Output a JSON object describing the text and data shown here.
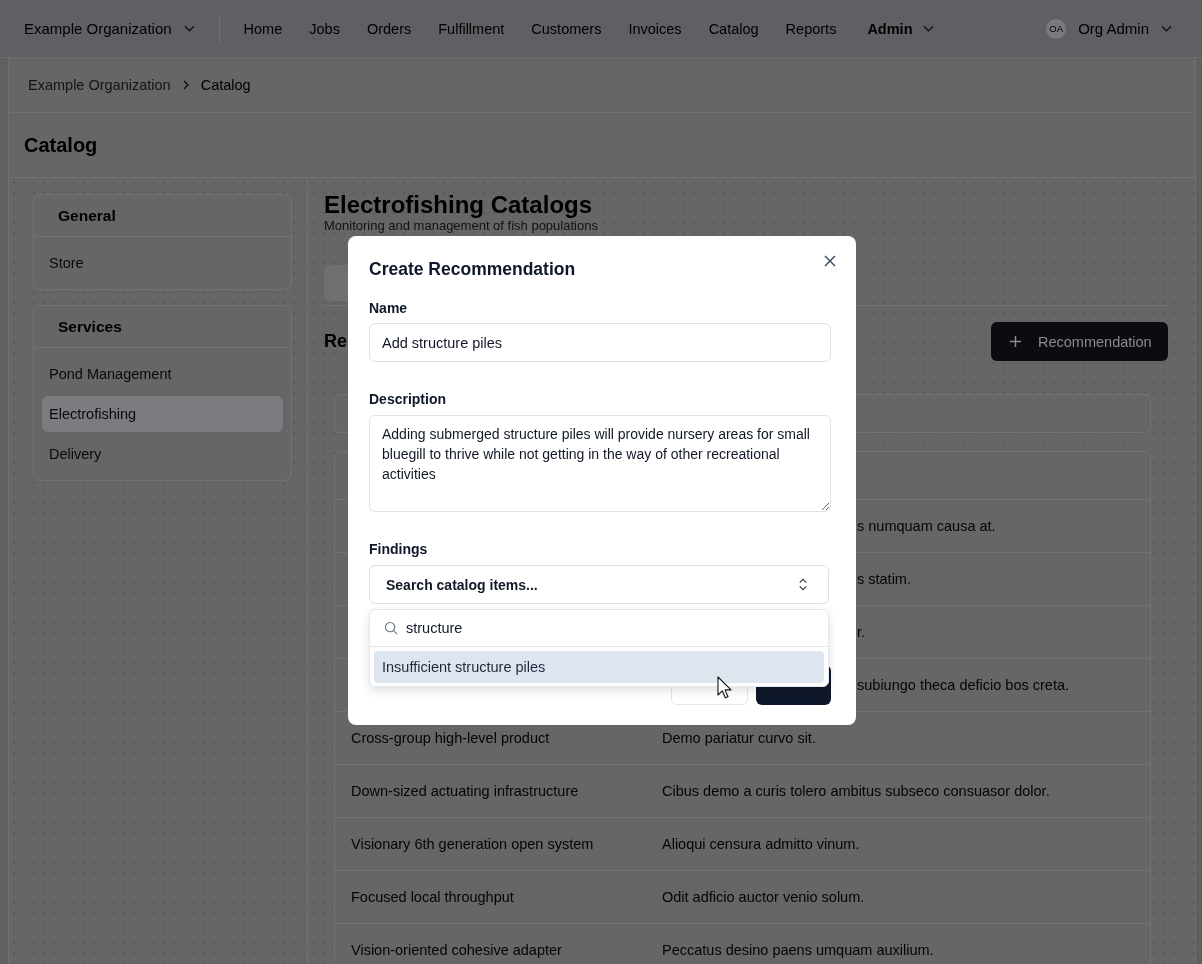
{
  "top_nav": {
    "organization": "Example Organization",
    "links": [
      {
        "label": "Home",
        "kind": "link"
      },
      {
        "label": "Jobs",
        "kind": "link"
      },
      {
        "label": "Orders",
        "kind": "link"
      },
      {
        "label": "Fulfillment",
        "kind": "link"
      },
      {
        "label": "Customers",
        "kind": "link"
      },
      {
        "label": "Invoices",
        "kind": "link"
      },
      {
        "label": "Catalog",
        "kind": "link"
      },
      {
        "label": "Reports",
        "kind": "link"
      },
      {
        "label": "Admin",
        "kind": "dropdown"
      }
    ],
    "user": {
      "initials": "OA",
      "name": "Org Admin"
    }
  },
  "breadcrumbs": [
    {
      "label": "Example Organization",
      "current": false
    },
    {
      "label": "Catalog",
      "current": true
    }
  ],
  "page_title": "Catalog",
  "sidebar": {
    "sections": [
      {
        "title": "General",
        "items": [
          {
            "label": "Store",
            "selected": false
          }
        ]
      },
      {
        "title": "Services",
        "items": [
          {
            "label": "Pond Management",
            "selected": false
          },
          {
            "label": "Electrofishing",
            "selected": true
          },
          {
            "label": "Delivery",
            "selected": false
          }
        ]
      }
    ]
  },
  "main": {
    "title": "Electrofishing Catalogs",
    "subtitle": "Monitoring and management of fish populations",
    "section_title": "Re",
    "add_button": "Recommendation",
    "table": {
      "rows": [
        {
          "kind": "fragment",
          "description": "s numquam causa at."
        },
        {
          "kind": "fragment",
          "description": "s statim."
        },
        {
          "kind": "fragment",
          "description": "r."
        },
        {
          "kind": "fragment",
          "description": "subiungo theca deficio bos creta."
        },
        {
          "kind": "full",
          "name": "Cross-group high-level product",
          "description": "Demo pariatur curvo sit."
        },
        {
          "kind": "full",
          "name": "Down-sized actuating infrastructure",
          "description": "Cibus demo a curis tolero ambitus subseco consuasor dolor."
        },
        {
          "kind": "full",
          "name": "Visionary 6th generation open system",
          "description": "Alioqui censura admitto vinum."
        },
        {
          "kind": "full",
          "name": "Focused local throughput",
          "description": "Odit adficio auctor venio solum."
        },
        {
          "kind": "full",
          "name": "Vision-oriented cohesive adapter",
          "description": "Peccatus desino paens umquam auxilium."
        }
      ]
    }
  },
  "dialog": {
    "title": "Create Recommendation",
    "fields": [
      {
        "kind": "text",
        "label": "Name",
        "value": "Add structure piles"
      },
      {
        "kind": "textarea",
        "label": "Description",
        "value": "Adding submerged structure piles will provide nursery areas for small bluegill to thrive while not getting in the way of other recreational activities"
      },
      {
        "kind": "combobox",
        "label": "Findings",
        "button_text": "Search catalog items..."
      }
    ],
    "buttons": [
      {
        "kind": "secondary"
      },
      {
        "kind": "primary"
      }
    ],
    "popover": {
      "search_value": "structure",
      "options": [
        {
          "label": "Insufficient structure piles",
          "selected": true
        }
      ]
    }
  }
}
